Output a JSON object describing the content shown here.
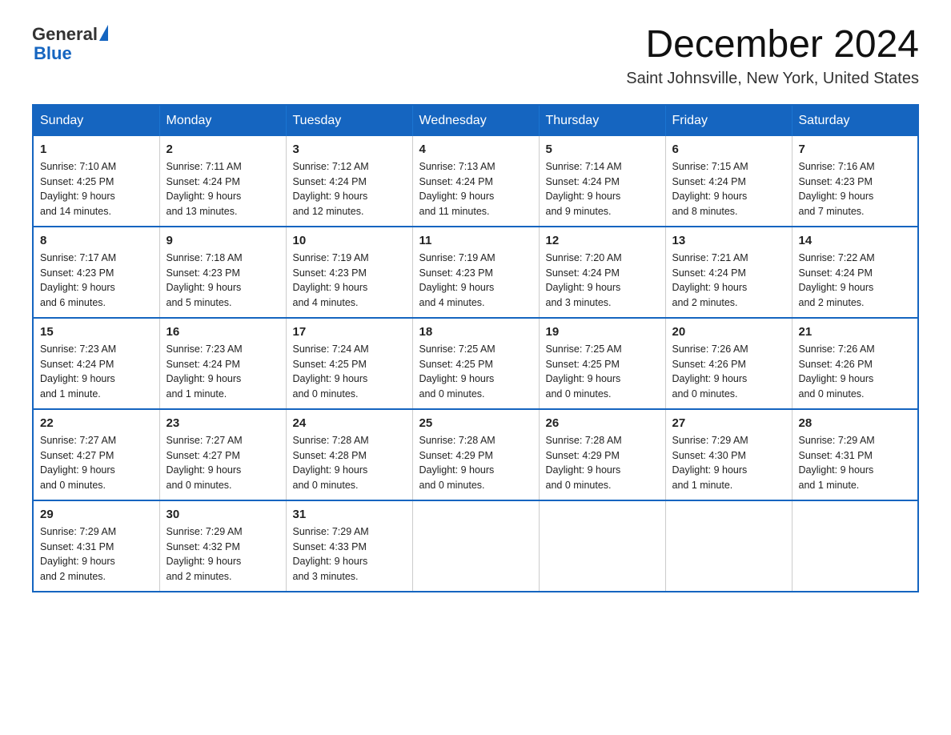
{
  "header": {
    "logo_general": "General",
    "logo_blue": "Blue",
    "month_year": "December 2024",
    "location": "Saint Johnsville, New York, United States"
  },
  "calendar": {
    "days_of_week": [
      "Sunday",
      "Monday",
      "Tuesday",
      "Wednesday",
      "Thursday",
      "Friday",
      "Saturday"
    ],
    "weeks": [
      [
        {
          "day": "1",
          "sunrise": "7:10 AM",
          "sunset": "4:25 PM",
          "daylight": "9 hours and 14 minutes."
        },
        {
          "day": "2",
          "sunrise": "7:11 AM",
          "sunset": "4:24 PM",
          "daylight": "9 hours and 13 minutes."
        },
        {
          "day": "3",
          "sunrise": "7:12 AM",
          "sunset": "4:24 PM",
          "daylight": "9 hours and 12 minutes."
        },
        {
          "day": "4",
          "sunrise": "7:13 AM",
          "sunset": "4:24 PM",
          "daylight": "9 hours and 11 minutes."
        },
        {
          "day": "5",
          "sunrise": "7:14 AM",
          "sunset": "4:24 PM",
          "daylight": "9 hours and 9 minutes."
        },
        {
          "day": "6",
          "sunrise": "7:15 AM",
          "sunset": "4:24 PM",
          "daylight": "9 hours and 8 minutes."
        },
        {
          "day": "7",
          "sunrise": "7:16 AM",
          "sunset": "4:23 PM",
          "daylight": "9 hours and 7 minutes."
        }
      ],
      [
        {
          "day": "8",
          "sunrise": "7:17 AM",
          "sunset": "4:23 PM",
          "daylight": "9 hours and 6 minutes."
        },
        {
          "day": "9",
          "sunrise": "7:18 AM",
          "sunset": "4:23 PM",
          "daylight": "9 hours and 5 minutes."
        },
        {
          "day": "10",
          "sunrise": "7:19 AM",
          "sunset": "4:23 PM",
          "daylight": "9 hours and 4 minutes."
        },
        {
          "day": "11",
          "sunrise": "7:19 AM",
          "sunset": "4:23 PM",
          "daylight": "9 hours and 4 minutes."
        },
        {
          "day": "12",
          "sunrise": "7:20 AM",
          "sunset": "4:24 PM",
          "daylight": "9 hours and 3 minutes."
        },
        {
          "day": "13",
          "sunrise": "7:21 AM",
          "sunset": "4:24 PM",
          "daylight": "9 hours and 2 minutes."
        },
        {
          "day": "14",
          "sunrise": "7:22 AM",
          "sunset": "4:24 PM",
          "daylight": "9 hours and 2 minutes."
        }
      ],
      [
        {
          "day": "15",
          "sunrise": "7:23 AM",
          "sunset": "4:24 PM",
          "daylight": "9 hours and 1 minute."
        },
        {
          "day": "16",
          "sunrise": "7:23 AM",
          "sunset": "4:24 PM",
          "daylight": "9 hours and 1 minute."
        },
        {
          "day": "17",
          "sunrise": "7:24 AM",
          "sunset": "4:25 PM",
          "daylight": "9 hours and 0 minutes."
        },
        {
          "day": "18",
          "sunrise": "7:25 AM",
          "sunset": "4:25 PM",
          "daylight": "9 hours and 0 minutes."
        },
        {
          "day": "19",
          "sunrise": "7:25 AM",
          "sunset": "4:25 PM",
          "daylight": "9 hours and 0 minutes."
        },
        {
          "day": "20",
          "sunrise": "7:26 AM",
          "sunset": "4:26 PM",
          "daylight": "9 hours and 0 minutes."
        },
        {
          "day": "21",
          "sunrise": "7:26 AM",
          "sunset": "4:26 PM",
          "daylight": "9 hours and 0 minutes."
        }
      ],
      [
        {
          "day": "22",
          "sunrise": "7:27 AM",
          "sunset": "4:27 PM",
          "daylight": "9 hours and 0 minutes."
        },
        {
          "day": "23",
          "sunrise": "7:27 AM",
          "sunset": "4:27 PM",
          "daylight": "9 hours and 0 minutes."
        },
        {
          "day": "24",
          "sunrise": "7:28 AM",
          "sunset": "4:28 PM",
          "daylight": "9 hours and 0 minutes."
        },
        {
          "day": "25",
          "sunrise": "7:28 AM",
          "sunset": "4:29 PM",
          "daylight": "9 hours and 0 minutes."
        },
        {
          "day": "26",
          "sunrise": "7:28 AM",
          "sunset": "4:29 PM",
          "daylight": "9 hours and 0 minutes."
        },
        {
          "day": "27",
          "sunrise": "7:29 AM",
          "sunset": "4:30 PM",
          "daylight": "9 hours and 1 minute."
        },
        {
          "day": "28",
          "sunrise": "7:29 AM",
          "sunset": "4:31 PM",
          "daylight": "9 hours and 1 minute."
        }
      ],
      [
        {
          "day": "29",
          "sunrise": "7:29 AM",
          "sunset": "4:31 PM",
          "daylight": "9 hours and 2 minutes."
        },
        {
          "day": "30",
          "sunrise": "7:29 AM",
          "sunset": "4:32 PM",
          "daylight": "9 hours and 2 minutes."
        },
        {
          "day": "31",
          "sunrise": "7:29 AM",
          "sunset": "4:33 PM",
          "daylight": "9 hours and 3 minutes."
        },
        null,
        null,
        null,
        null
      ]
    ],
    "sunrise_label": "Sunrise:",
    "sunset_label": "Sunset:",
    "daylight_label": "Daylight:"
  }
}
